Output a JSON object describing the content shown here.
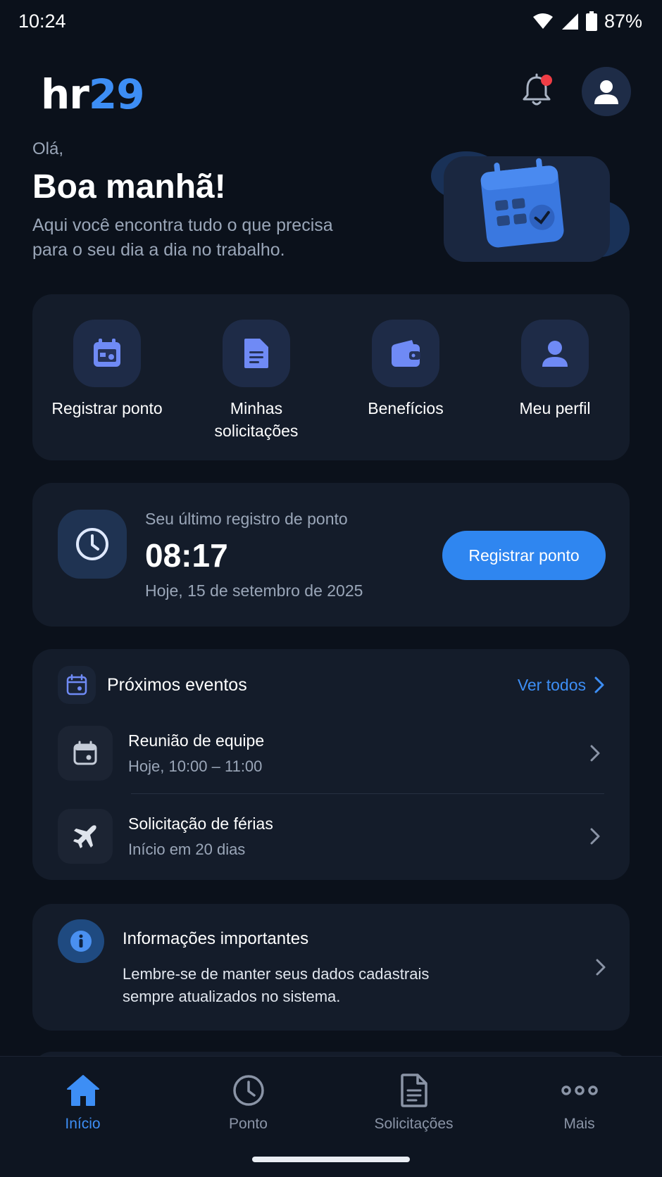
{
  "status_bar": {
    "time": "10:24",
    "battery": "87%"
  },
  "header": {
    "logo_part1": "hr",
    "logo_part2": "29"
  },
  "greeting": {
    "hello": "Olá,",
    "title": "Boa manhã!",
    "subtitle": "Aqui você encontra tudo o que precisa para o seu dia a dia no trabalho."
  },
  "quick_actions": [
    {
      "label": "Registrar ponto",
      "icon": "calendar-icon"
    },
    {
      "label": "Minhas solicitações",
      "icon": "document-icon"
    },
    {
      "label": "Benefícios",
      "icon": "wallet-icon"
    },
    {
      "label": "Meu perfil",
      "icon": "user-icon"
    }
  ],
  "last_punch": {
    "label": "Seu último registro de ponto",
    "time": "08:17",
    "date": "Hoje, 15 de setembro de 2025",
    "button_label": "Registrar ponto"
  },
  "events": {
    "title": "Próximos eventos",
    "see_all": "Ver todos",
    "items": [
      {
        "title": "Reunião de equipe",
        "subtitle": "Hoje, 10:00 – 11:00",
        "icon": "calendar-icon"
      },
      {
        "title": "Solicitação de férias",
        "subtitle": "Início em 20 dias",
        "icon": "airplane-icon"
      }
    ]
  },
  "info": {
    "title": "Informações importantes",
    "text": "Lembre-se de manter seus dados cadastrais sempre atualizados no sistema."
  },
  "bottom_nav": {
    "items": [
      {
        "label": "Início",
        "icon": "home-icon",
        "active": true
      },
      {
        "label": "Ponto",
        "icon": "clock-icon",
        "active": false
      },
      {
        "label": "Solicitações",
        "icon": "document-icon",
        "active": false
      },
      {
        "label": "Mais",
        "icon": "more-icon",
        "active": false
      }
    ]
  },
  "colors": {
    "background": "#0b111b",
    "card": "#141c2a",
    "accent": "#3d8ef5",
    "primary_button": "#2f86f0",
    "notification_dot": "#ef3d45"
  }
}
